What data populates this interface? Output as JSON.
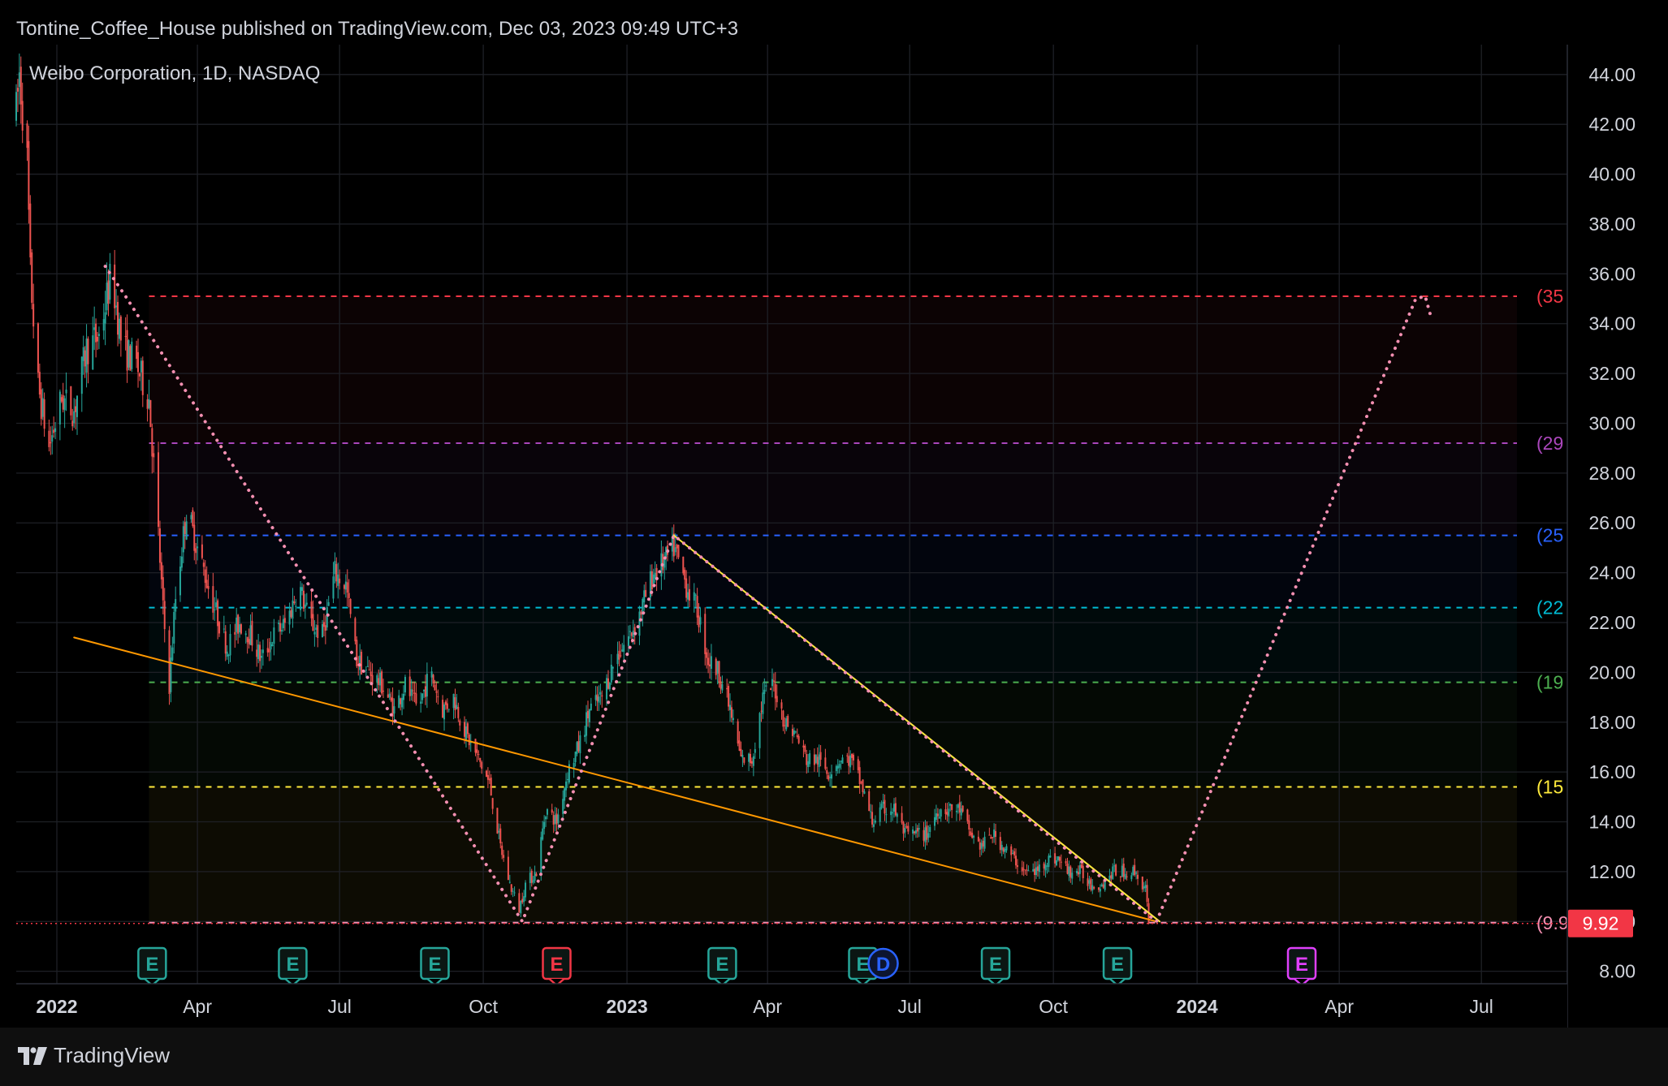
{
  "header": {
    "published": "Tontine_Coffee_House published on TradingView.com, Dec 03, 2023 09:49 UTC+3"
  },
  "symbol": {
    "title": "Weibo Corporation, 1D, NASDAQ"
  },
  "footer": {
    "brand": "TradingView"
  },
  "colors": {
    "up": "#26a69a",
    "down": "#ef5350",
    "projection": "#f48fb1",
    "wedge_lower": "#ff9800",
    "wedge_upper": "#ffeb3b",
    "last_price_bg": "#f23645"
  },
  "chart_data": {
    "type": "candlestick",
    "symbol": "Weibo Corporation, 1D, NASDAQ",
    "ylim": [
      7.5,
      45.2
    ],
    "y_ticks": [
      "44.00",
      "42.00",
      "40.00",
      "38.00",
      "36.00",
      "34.00",
      "32.00",
      "30.00",
      "28.00",
      "26.00",
      "24.00",
      "22.00",
      "20.00",
      "18.00",
      "16.00",
      "14.00",
      "12.00",
      "10.00",
      "8.00"
    ],
    "x_ticks": [
      {
        "label": "2022",
        "date": "2022-01-01",
        "bold": true
      },
      {
        "label": "Apr",
        "date": "2022-04-01",
        "bold": false
      },
      {
        "label": "Jul",
        "date": "2022-07-01",
        "bold": false
      },
      {
        "label": "Oct",
        "date": "2022-10-01",
        "bold": false
      },
      {
        "label": "2023",
        "date": "2023-01-01",
        "bold": true
      },
      {
        "label": "Apr",
        "date": "2023-04-01",
        "bold": false
      },
      {
        "label": "Jul",
        "date": "2023-07-01",
        "bold": false
      },
      {
        "label": "Oct",
        "date": "2023-10-01",
        "bold": false
      },
      {
        "label": "2024",
        "date": "2024-01-01",
        "bold": true
      },
      {
        "label": "Apr",
        "date": "2024-04-01",
        "bold": false
      },
      {
        "label": "Jul",
        "date": "2024-07-01",
        "bold": false
      }
    ],
    "last_price": {
      "value": 9.92,
      "label": "9.92"
    },
    "price_path": [
      [
        "2021-12-06",
        42.5
      ],
      [
        "2021-12-08",
        44.0
      ],
      [
        "2021-12-13",
        40.5
      ],
      [
        "2021-12-15",
        36.0
      ],
      [
        "2021-12-20",
        31.5
      ],
      [
        "2021-12-27",
        29.0
      ],
      [
        "2022-01-04",
        31.0
      ],
      [
        "2022-01-12",
        30.5
      ],
      [
        "2022-01-20",
        33.0
      ],
      [
        "2022-01-28",
        33.5
      ],
      [
        "2022-02-05",
        36.0
      ],
      [
        "2022-02-12",
        33.0
      ],
      [
        "2022-02-20",
        32.5
      ],
      [
        "2022-03-01",
        31.0
      ],
      [
        "2022-03-06",
        26.5
      ],
      [
        "2022-03-10",
        22.5
      ],
      [
        "2022-03-14",
        19.5
      ],
      [
        "2022-03-18",
        23.0
      ],
      [
        "2022-03-25",
        26.5
      ],
      [
        "2022-04-01",
        25.0
      ],
      [
        "2022-04-10",
        23.0
      ],
      [
        "2022-04-20",
        21.0
      ],
      [
        "2022-04-28",
        22.0
      ],
      [
        "2022-05-05",
        21.5
      ],
      [
        "2022-05-12",
        20.5
      ],
      [
        "2022-05-20",
        21.5
      ],
      [
        "2022-05-28",
        22.0
      ],
      [
        "2022-06-05",
        23.5
      ],
      [
        "2022-06-12",
        22.0
      ],
      [
        "2022-06-20",
        21.5
      ],
      [
        "2022-06-28",
        24.0
      ],
      [
        "2022-07-05",
        23.5
      ],
      [
        "2022-07-12",
        20.5
      ],
      [
        "2022-07-20",
        20.0
      ],
      [
        "2022-07-28",
        19.5
      ],
      [
        "2022-08-05",
        18.5
      ],
      [
        "2022-08-12",
        19.5
      ],
      [
        "2022-08-20",
        18.5
      ],
      [
        "2022-08-28",
        20.0
      ],
      [
        "2022-09-05",
        18.5
      ],
      [
        "2022-09-12",
        19.0
      ],
      [
        "2022-09-20",
        17.5
      ],
      [
        "2022-09-28",
        16.5
      ],
      [
        "2022-10-05",
        15.5
      ],
      [
        "2022-10-12",
        13.0
      ],
      [
        "2022-10-18",
        11.5
      ],
      [
        "2022-10-24",
        10.5
      ],
      [
        "2022-10-28",
        11.5
      ],
      [
        "2022-11-04",
        12.0
      ],
      [
        "2022-11-10",
        14.5
      ],
      [
        "2022-11-17",
        14.0
      ],
      [
        "2022-11-24",
        16.0
      ],
      [
        "2022-12-01",
        17.0
      ],
      [
        "2022-12-08",
        18.5
      ],
      [
        "2022-12-16",
        19.0
      ],
      [
        "2022-12-24",
        20.5
      ],
      [
        "2023-01-03",
        21.5
      ],
      [
        "2023-01-10",
        22.5
      ],
      [
        "2023-01-18",
        24.0
      ],
      [
        "2023-01-26",
        24.5
      ],
      [
        "2023-01-31",
        25.0
      ],
      [
        "2023-02-08",
        23.5
      ],
      [
        "2023-02-15",
        22.5
      ],
      [
        "2023-02-22",
        20.5
      ],
      [
        "2023-03-01",
        20.0
      ],
      [
        "2023-03-08",
        18.5
      ],
      [
        "2023-03-15",
        16.5
      ],
      [
        "2023-03-22",
        16.5
      ],
      [
        "2023-03-29",
        19.0
      ],
      [
        "2023-04-05",
        19.5
      ],
      [
        "2023-04-12",
        18.0
      ],
      [
        "2023-04-19",
        17.5
      ],
      [
        "2023-04-26",
        16.5
      ],
      [
        "2023-05-03",
        16.5
      ],
      [
        "2023-05-10",
        16.0
      ],
      [
        "2023-05-17",
        16.5
      ],
      [
        "2023-05-24",
        16.5
      ],
      [
        "2023-05-31",
        15.5
      ],
      [
        "2023-06-07",
        14.0
      ],
      [
        "2023-06-14",
        14.5
      ],
      [
        "2023-06-21",
        14.5
      ],
      [
        "2023-06-28",
        13.5
      ],
      [
        "2023-07-05",
        13.5
      ],
      [
        "2023-07-12",
        13.5
      ],
      [
        "2023-07-19",
        14.5
      ],
      [
        "2023-07-26",
        14.5
      ],
      [
        "2023-08-02",
        14.5
      ],
      [
        "2023-08-09",
        13.5
      ],
      [
        "2023-08-16",
        13.0
      ],
      [
        "2023-08-23",
        13.5
      ],
      [
        "2023-08-30",
        13.0
      ],
      [
        "2023-09-06",
        12.5
      ],
      [
        "2023-09-13",
        12.0
      ],
      [
        "2023-09-20",
        12.0
      ],
      [
        "2023-09-27",
        12.5
      ],
      [
        "2023-10-04",
        12.5
      ],
      [
        "2023-10-11",
        12.0
      ],
      [
        "2023-10-18",
        12.0
      ],
      [
        "2023-10-25",
        11.5
      ],
      [
        "2023-11-01",
        11.5
      ],
      [
        "2023-11-08",
        12.0
      ],
      [
        "2023-11-15",
        12.0
      ],
      [
        "2023-11-22",
        12.0
      ],
      [
        "2023-11-29",
        11.3
      ],
      [
        "2023-12-01",
        9.92
      ]
    ],
    "horizontal_levels": [
      {
        "value": 35.1,
        "label": "(35",
        "color": "#f23645"
      },
      {
        "value": 29.2,
        "label": "(29",
        "color": "#ab47bc"
      },
      {
        "value": 25.5,
        "label": "(25",
        "color": "#2962ff"
      },
      {
        "value": 22.6,
        "label": "(22",
        "color": "#00bcd4"
      },
      {
        "value": 19.6,
        "label": "(19",
        "color": "#4caf50"
      },
      {
        "value": 15.4,
        "label": "(15",
        "color": "#ffeb3b"
      },
      {
        "value": 9.95,
        "label": "(9.9",
        "color": "#f48fb1"
      }
    ],
    "trendlines": [
      {
        "name": "wedge-lower",
        "color": "#ff9800",
        "style": "solid",
        "points": [
          [
            "2022-01-12",
            21.4
          ],
          [
            "2023-12-06",
            10.0
          ]
        ]
      },
      {
        "name": "wedge-upper",
        "color": "#ffeb3b",
        "style": "solid",
        "points": [
          [
            "2023-01-31",
            25.5
          ],
          [
            "2023-12-08",
            10.0
          ]
        ]
      },
      {
        "name": "wave-projection",
        "color": "#f48fb1",
        "style": "dotted",
        "points": [
          [
            "2022-02-01",
            36.3
          ],
          [
            "2022-02-15",
            35.0
          ],
          [
            "2022-10-26",
            10.0
          ],
          [
            "2023-01-31",
            25.5
          ],
          [
            "2023-12-06",
            10.0
          ],
          [
            "2024-05-20",
            35.0
          ],
          [
            "2024-05-26",
            35.1
          ],
          [
            "2024-05-30",
            34.2
          ]
        ]
      }
    ],
    "events": [
      {
        "label": "E",
        "date": "2022-03-03",
        "color": "#26a69a"
      },
      {
        "label": "E",
        "date": "2022-06-01",
        "color": "#26a69a"
      },
      {
        "label": "E",
        "date": "2022-08-31",
        "color": "#26a69a"
      },
      {
        "label": "E",
        "date": "2022-11-17",
        "color": "#f23645"
      },
      {
        "label": "E",
        "date": "2023-03-03",
        "color": "#26a69a"
      },
      {
        "label": "E",
        "date": "2023-06-01",
        "color": "#26a69a"
      },
      {
        "label": "D",
        "date": "2023-06-14",
        "color": "#2962ff"
      },
      {
        "label": "E",
        "date": "2023-08-25",
        "color": "#26a69a"
      },
      {
        "label": "E",
        "date": "2023-11-11",
        "color": "#26a69a"
      },
      {
        "label": "E",
        "date": "2024-03-08",
        "color": "#e040fb"
      }
    ]
  }
}
